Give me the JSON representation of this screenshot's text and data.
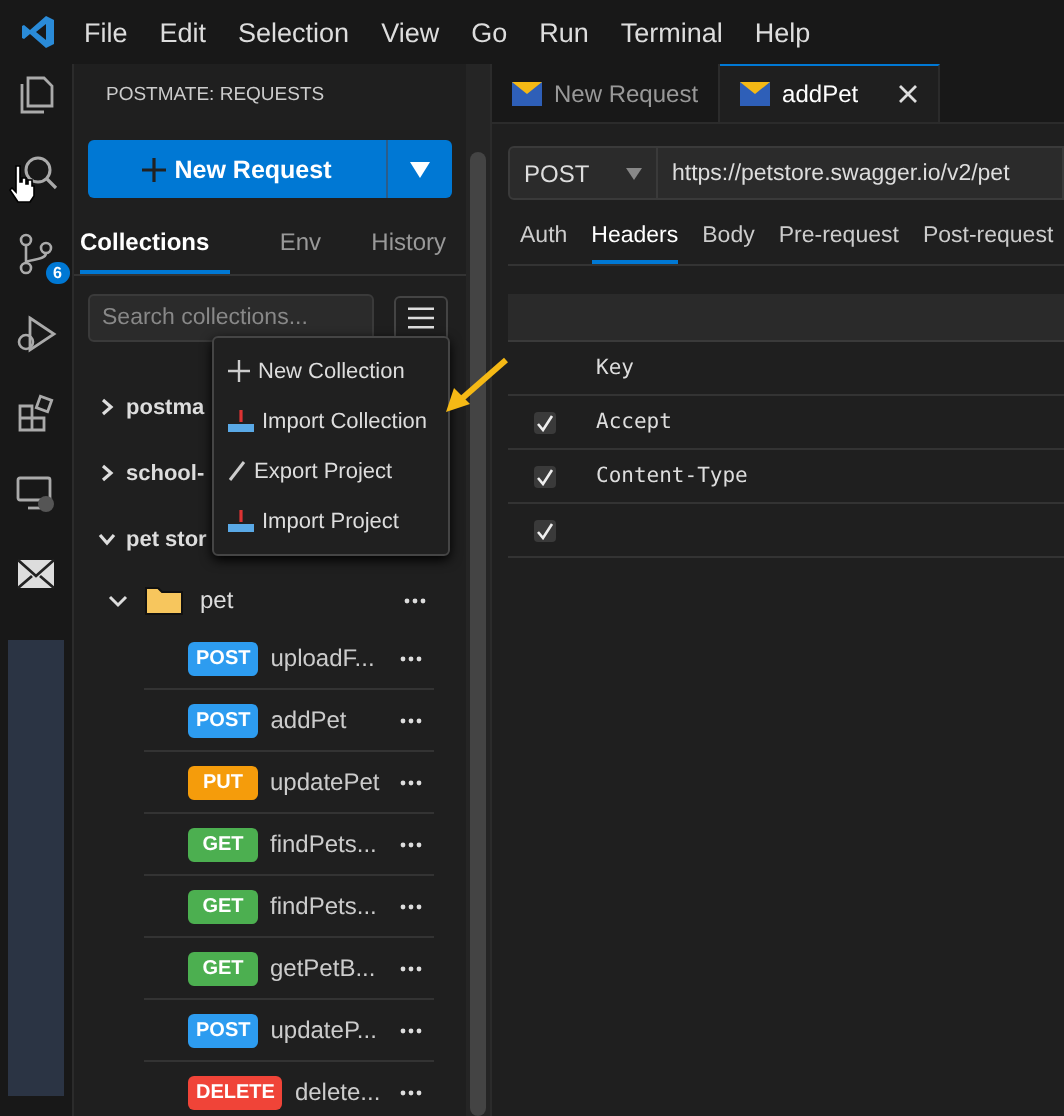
{
  "menu_bar": {
    "items": [
      "File",
      "Edit",
      "Selection",
      "View",
      "Go",
      "Run",
      "Terminal",
      "Help"
    ]
  },
  "activity_bar": {
    "source_control_badge": "6"
  },
  "sidebar": {
    "title": "POSTMATE: REQUESTS",
    "new_request_button": "New Request",
    "tabs": [
      {
        "label": "Collections",
        "selected": true
      },
      {
        "label": "Env",
        "selected": false
      },
      {
        "label": "History",
        "selected": false
      }
    ],
    "search": {
      "placeholder": "Search collections..."
    },
    "menu": [
      {
        "label": "New Collection",
        "kind": "plus"
      },
      {
        "label": "Import Collection",
        "kind": "import"
      },
      {
        "label": "Export Project",
        "kind": "export"
      },
      {
        "label": "Import Project",
        "kind": "import"
      }
    ],
    "collections": [
      {
        "label": "postma",
        "expanded": false
      },
      {
        "label": "school-",
        "expanded": false
      },
      {
        "label": "pet stor",
        "expanded": true,
        "children": [
          {
            "label": "pet",
            "expanded": true,
            "children": [
              {
                "method": "POST",
                "color": "#2d9cf0",
                "label": "uploadF..."
              },
              {
                "method": "POST",
                "color": "#2d9cf0",
                "label": "addPet"
              },
              {
                "method": "PUT",
                "color": "#f59c0b",
                "label": "updatePet"
              },
              {
                "method": "GET",
                "color": "#4caf50",
                "label": "findPets..."
              },
              {
                "method": "GET",
                "color": "#4caf50",
                "label": "findPets..."
              },
              {
                "method": "GET",
                "color": "#4caf50",
                "label": "getPetB..."
              },
              {
                "method": "POST",
                "color": "#2d9cf0",
                "label": "updateP..."
              },
              {
                "method": "DELETE",
                "color": "#f04438",
                "label": "delete..."
              }
            ]
          }
        ]
      }
    ]
  },
  "editor": {
    "tabs": [
      {
        "label": "New Request",
        "selected": false
      },
      {
        "label": "addPet",
        "selected": true
      }
    ],
    "method": "POST",
    "url": "https://petstore.swagger.io/v2/pet",
    "request_tabs": [
      {
        "label": "Auth",
        "selected": false
      },
      {
        "label": "Headers",
        "selected": true
      },
      {
        "label": "Body",
        "selected": false
      },
      {
        "label": "Pre-request",
        "selected": false
      },
      {
        "label": "Post-request",
        "selected": false
      }
    ],
    "headers": {
      "columns": [
        "Key"
      ],
      "rows": [
        {
          "key": "Accept",
          "checked": true
        },
        {
          "key": "Content-Type",
          "checked": true
        },
        {
          "checked": true
        }
      ]
    }
  }
}
